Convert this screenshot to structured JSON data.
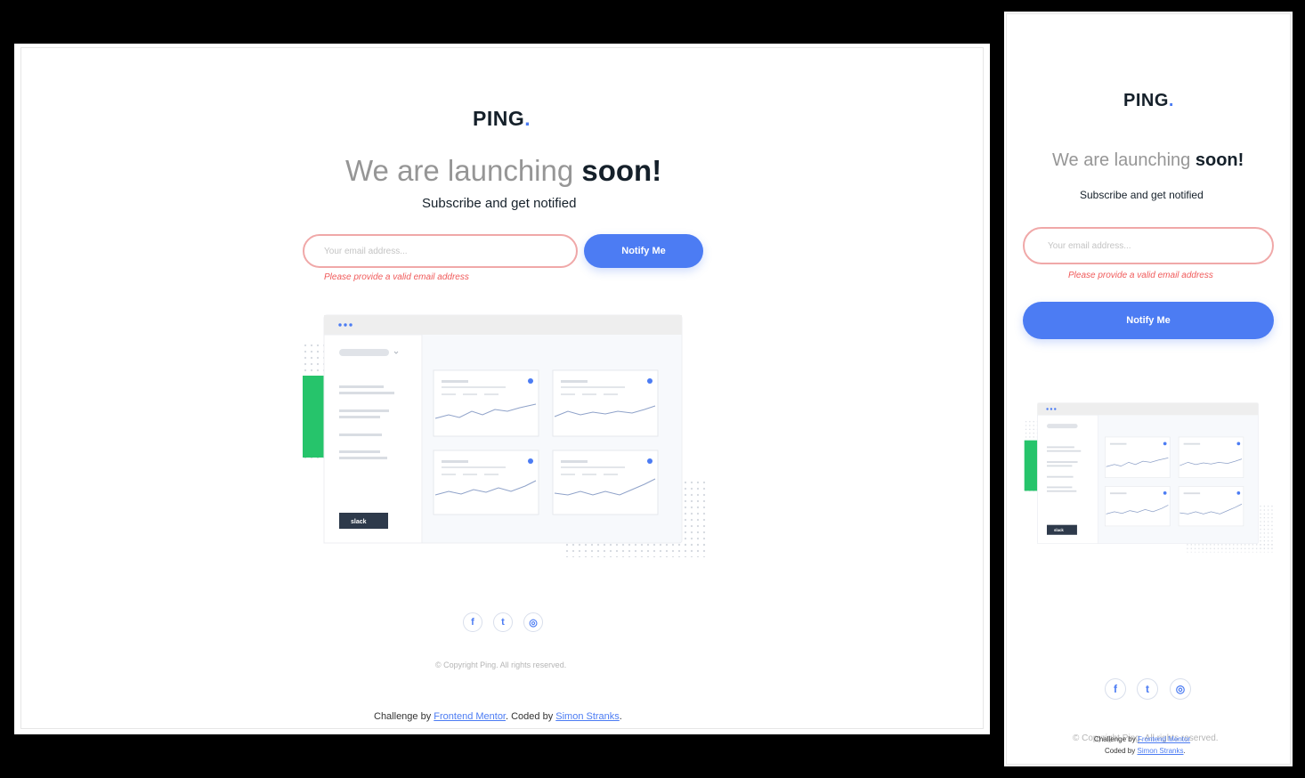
{
  "brand": {
    "name": "PING",
    "dot": ".",
    "accent_color": "#4c7cf3"
  },
  "hero": {
    "title_light": "We are launching",
    "title_bold": "soon!",
    "subtitle": "Subscribe and get notified"
  },
  "form": {
    "email_placeholder": "Your email address...",
    "error_message": "Please provide a valid email address",
    "submit_label": "Notify Me",
    "error_color": "#f05a5a"
  },
  "dashboard_illustration": {
    "button_label": "slack"
  },
  "social": [
    {
      "name": "facebook-icon",
      "glyph": "f"
    },
    {
      "name": "twitter-icon",
      "glyph": "t"
    },
    {
      "name": "instagram-icon",
      "glyph": "◎"
    }
  ],
  "footer": {
    "copyright": "© Copyright Ping. All rights reserved.",
    "challenge_by": "Challenge by",
    "frontend_mentor": "Frontend Mentor",
    "coded_by": ". Coded by",
    "coded_by_mobile": "Coded by",
    "author": "Simon Stranks",
    "period": "."
  }
}
